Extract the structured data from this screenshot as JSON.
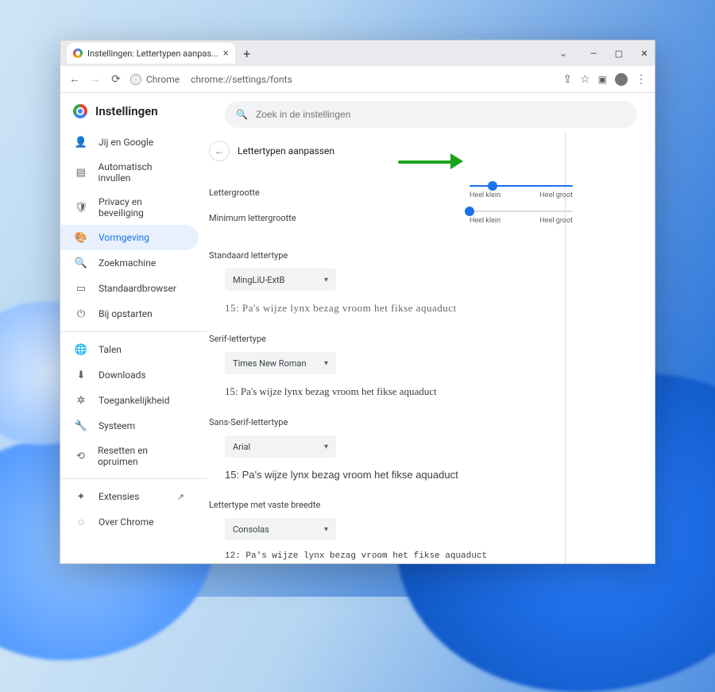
{
  "tab": {
    "title": "Instellingen: Lettertypen aanpas..."
  },
  "addressbar": {
    "chip_label": "Chrome",
    "url_host": "chrome://",
    "url_path": "settings/fonts"
  },
  "app": {
    "title": "Instellingen"
  },
  "search": {
    "placeholder": "Zoek in de instellingen"
  },
  "sidebar": {
    "items": [
      {
        "label": "Jij en Google",
        "icon": "person"
      },
      {
        "label": "Automatisch invullen",
        "icon": "autofill"
      },
      {
        "label": "Privacy en beveiliging",
        "icon": "shield"
      },
      {
        "label": "Vormgeving",
        "icon": "palette",
        "active": true
      },
      {
        "label": "Zoekmachine",
        "icon": "search"
      },
      {
        "label": "Standaardbrowser",
        "icon": "browser"
      },
      {
        "label": "Bij opstarten",
        "icon": "power"
      }
    ],
    "items2": [
      {
        "label": "Talen",
        "icon": "globe"
      },
      {
        "label": "Downloads",
        "icon": "download"
      },
      {
        "label": "Toegankelijkheid",
        "icon": "accessibility"
      },
      {
        "label": "Systeem",
        "icon": "wrench"
      },
      {
        "label": "Resetten en opruimen",
        "icon": "reset"
      }
    ],
    "items3": [
      {
        "label": "Extensies",
        "icon": "extension",
        "external": true
      },
      {
        "label": "Over Chrome",
        "icon": "info"
      }
    ]
  },
  "page": {
    "heading": "Lettertypen aanpassen",
    "fontsize_label": "Lettergrootte",
    "minsize_label": "Minimum lettergrootte",
    "slider": {
      "min_label": "Heel klein",
      "max_label": "Heel groot"
    },
    "sections": {
      "standard": {
        "label": "Standaard lettertype",
        "value": "MingLiU-ExtB",
        "sample": "15: Pa's wijze lynx bezag vroom het fikse aquaduct"
      },
      "serif": {
        "label": "Serif-lettertype",
        "value": "Times New Roman",
        "sample": "15: Pa's wijze lynx bezag vroom het fikse aquaduct"
      },
      "sans": {
        "label": "Sans-Serif-lettertype",
        "value": "Arial",
        "sample": "15: Pa's wijze lynx bezag vroom het fikse aquaduct"
      },
      "mono": {
        "label": "Lettertype met vaste breedte",
        "value": "Consolas",
        "sample": "12: Pa's wijze lynx bezag vroom het fikse aquaduct"
      }
    }
  }
}
